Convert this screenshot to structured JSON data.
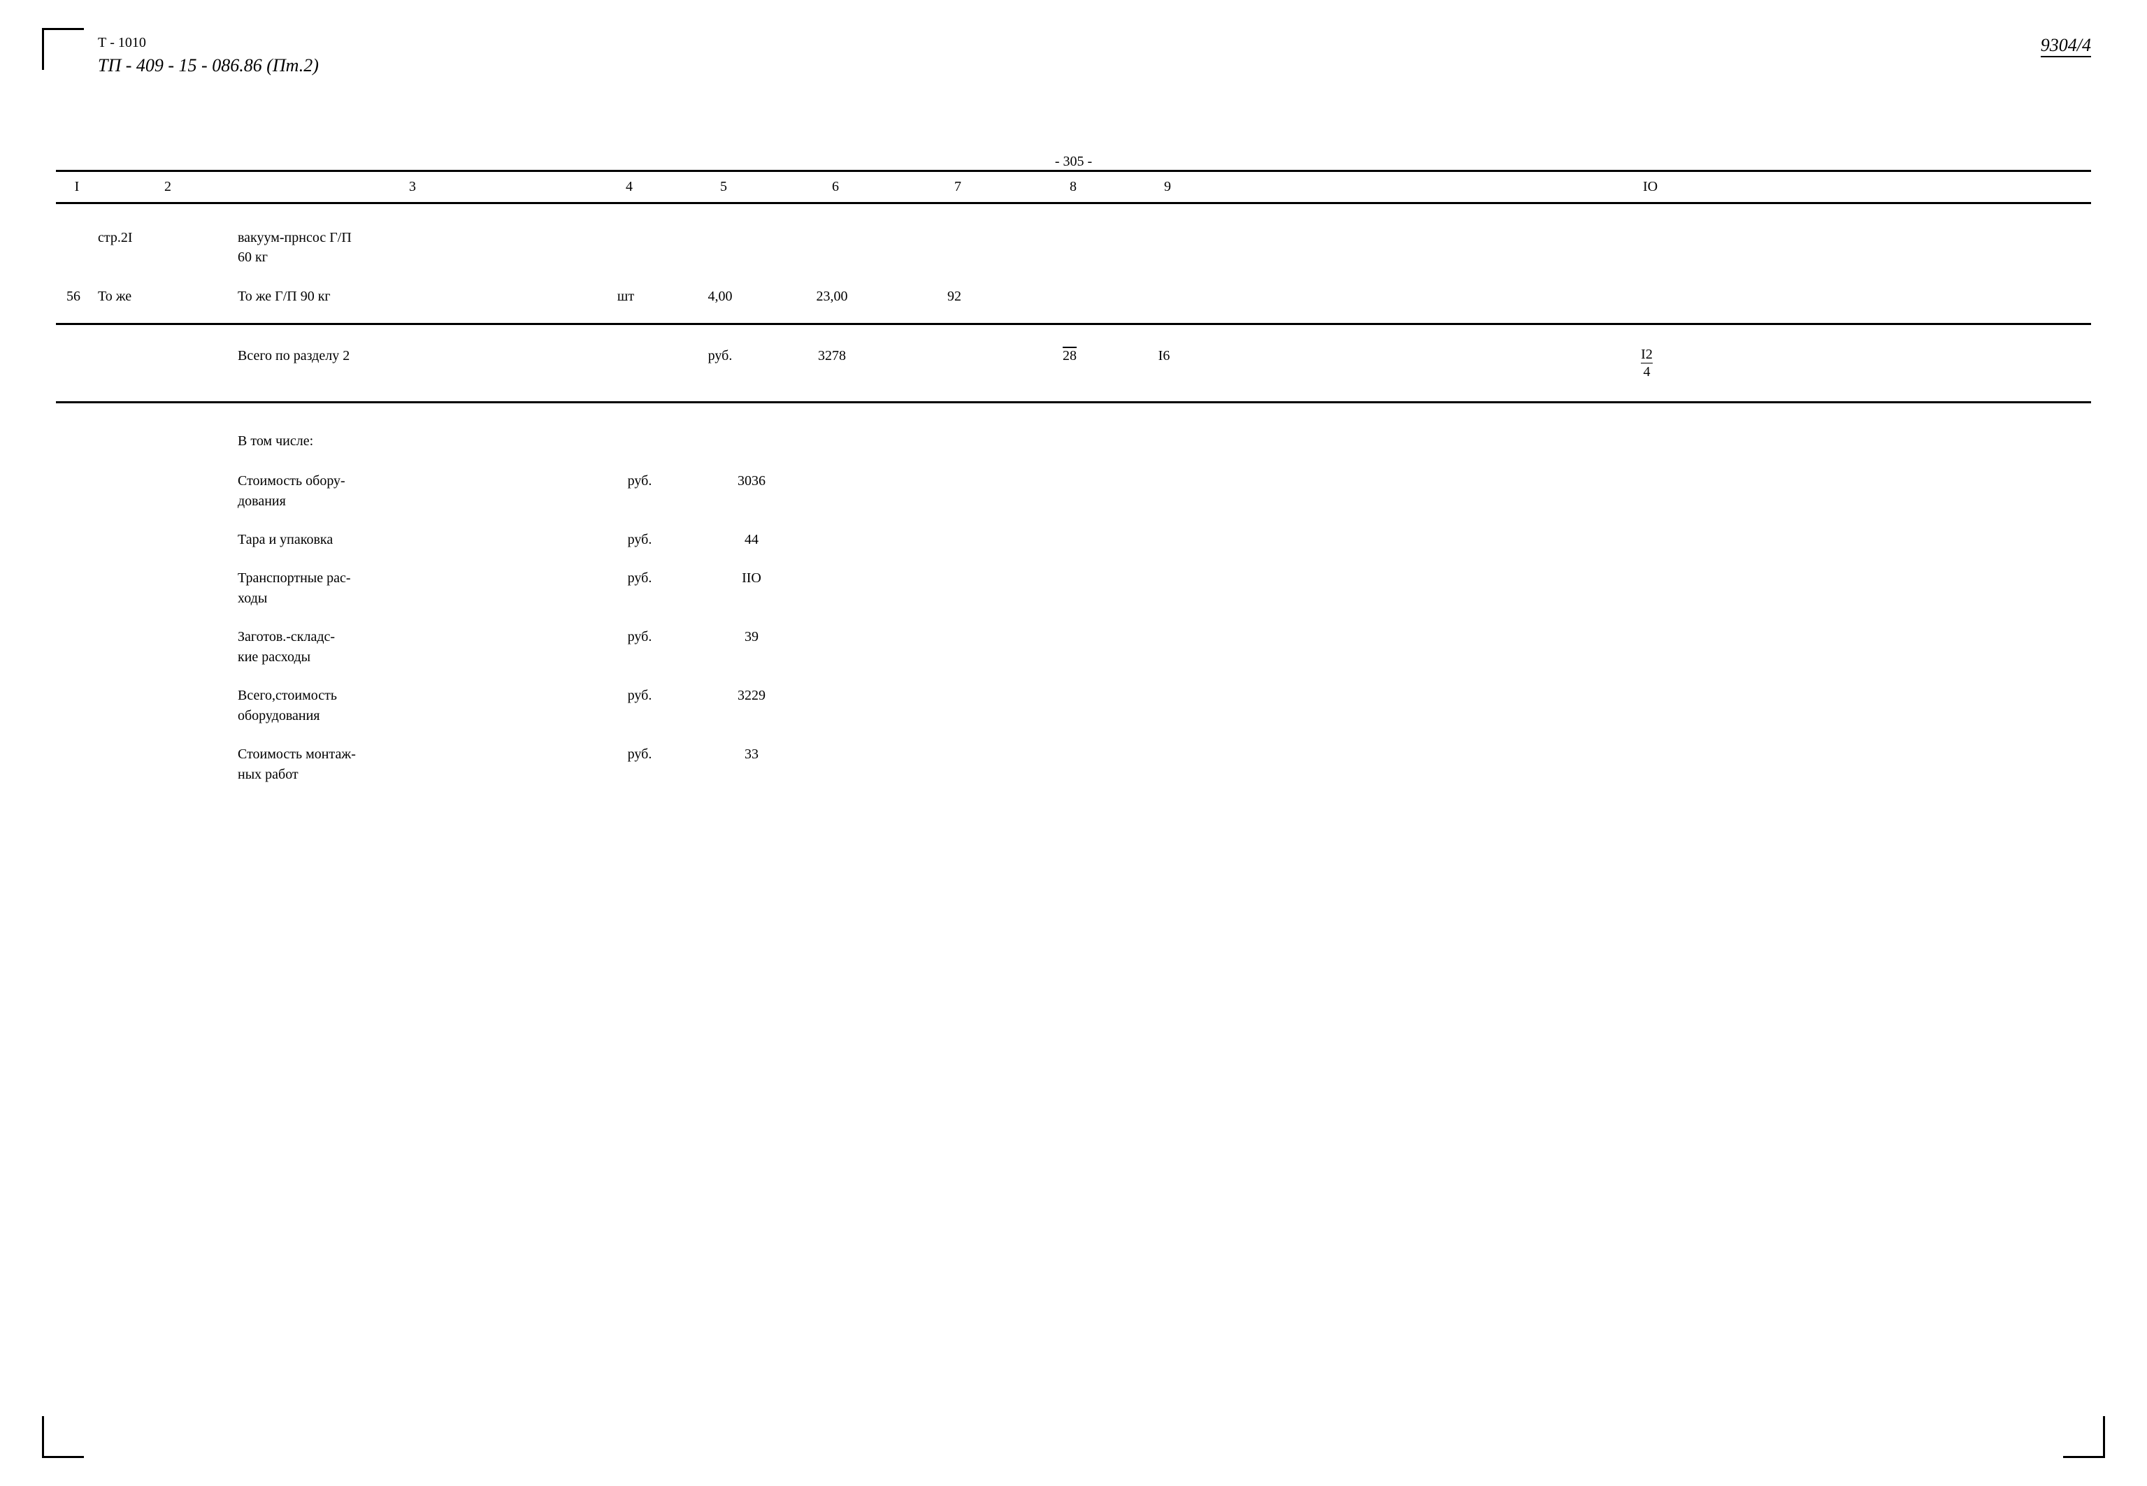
{
  "doc": {
    "title_top": "Т - 1010",
    "title_main": "ТП - 409 - 15 - 086.86 (Пт.2)",
    "doc_number": "9304/4",
    "page_number": "- 305 -"
  },
  "columns": {
    "headers": [
      "I",
      "2",
      "3",
      "4",
      "5",
      "6",
      "7",
      "8",
      "9",
      "IO"
    ]
  },
  "rows": [
    {
      "col1": "",
      "col2": "стр.2I",
      "col3": "вакуум-прнсос Г/П\n60 кг",
      "col4": "",
      "col5": "",
      "col6": "",
      "col7": "",
      "col8": "",
      "col9": "",
      "col10": ""
    },
    {
      "col1": "56",
      "col2": "То же",
      "col3": "То же Г/П 90 кг",
      "col4": "шт",
      "col5": "4,00",
      "col6": "23,00",
      "col7": "92",
      "col8": "",
      "col9": "",
      "col10": ""
    },
    {
      "col1": "",
      "col2": "",
      "col3": "Всего по разделу 2",
      "col4": "",
      "col5": "руб.",
      "col6": "3278",
      "col7": "",
      "col8_overline": "28",
      "col9": "I6",
      "col10_fraction": {
        "num": "I2",
        "den": "4"
      }
    }
  ],
  "subsection": {
    "title": "В том числе:",
    "items": [
      {
        "label": "Стоимость обору-\nдования",
        "unit": "руб.",
        "value": "3036"
      },
      {
        "label": "Тара и упаковка",
        "unit": "руб.",
        "value": "44"
      },
      {
        "label": "Транспортные рас-\nходы",
        "unit": "руб.",
        "value": "IIO"
      },
      {
        "label": "Заготов.-складс-\nкие расходы",
        "unit": "руб.",
        "value": "39"
      },
      {
        "label": "Всего,стоимость\nоборудования",
        "unit": "руб.",
        "value": "3229"
      },
      {
        "label": "Стоимость монтаж-\nных работ",
        "unit": "руб.",
        "value": "33"
      }
    ]
  }
}
